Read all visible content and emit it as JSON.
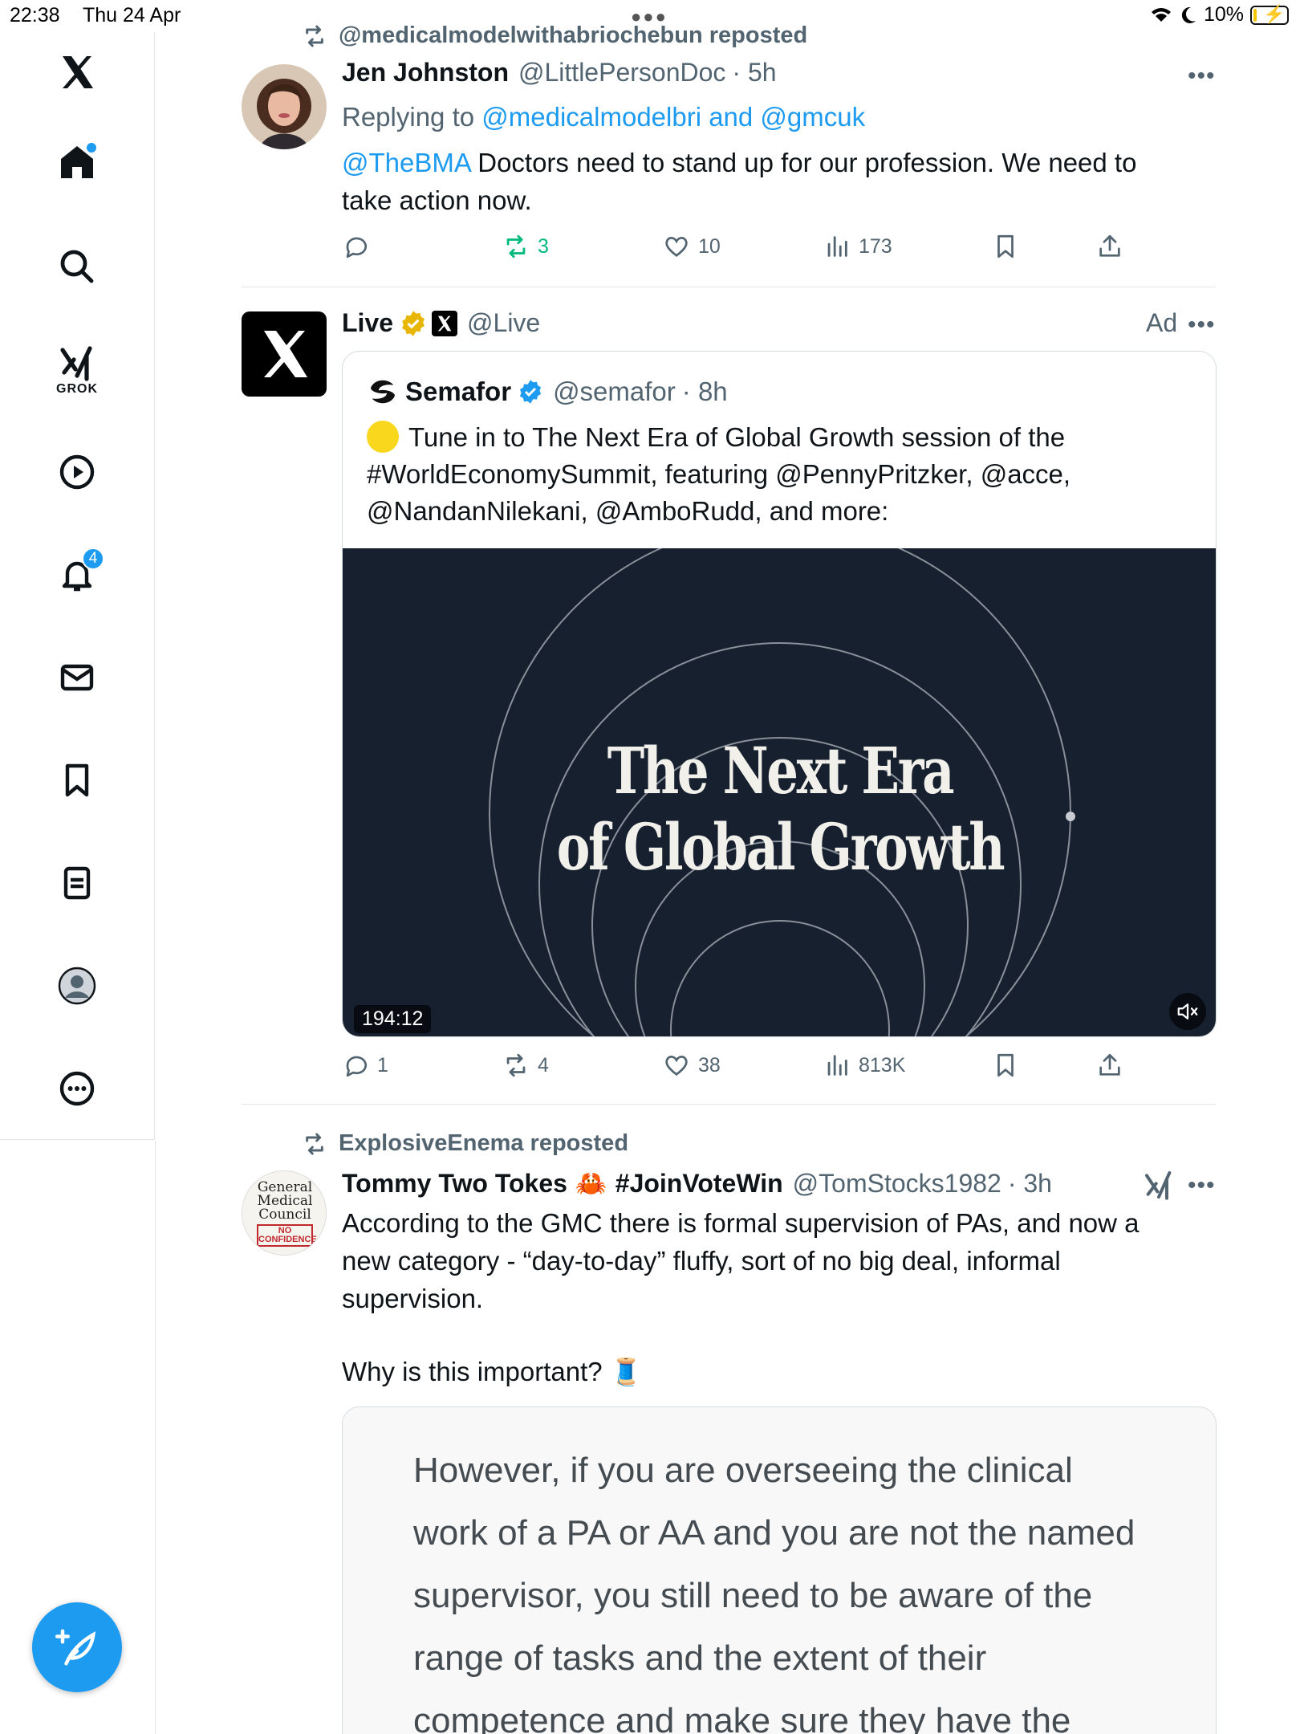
{
  "status_bar": {
    "time": "22:38",
    "date": "Thu 24 Apr",
    "battery": "10%",
    "battery_level": 0.1
  },
  "sidebar": {
    "items": [
      {
        "name": "x-logo-icon"
      },
      {
        "name": "home-icon",
        "has_unread": true
      },
      {
        "name": "search-icon"
      },
      {
        "name": "grok-icon",
        "label": "GROK"
      },
      {
        "name": "play-icon"
      },
      {
        "name": "bell-icon",
        "badge": "4"
      },
      {
        "name": "mail-icon"
      },
      {
        "name": "bookmark-icon"
      },
      {
        "name": "lists-icon"
      },
      {
        "name": "profile-icon"
      },
      {
        "name": "more-circle-icon"
      }
    ],
    "accent": "#1d9bf0"
  },
  "tweets": [
    {
      "repost_by": "@medicalmodelwithabriochebun reposted",
      "name": "Jen Johnston",
      "handle": "@LittlePersonDoc",
      "time": "· 5h",
      "replying_prefix": "Replying to ",
      "replying_to": "@medicalmodelbri and @gmcuk",
      "mention": "@TheBMA",
      "text_line1": " Doctors need to stand up for our profession. We need to",
      "text_line2": "take action now.",
      "actions": {
        "replies": "",
        "reposts": "3",
        "likes": "10",
        "views": "173"
      }
    },
    {
      "name": "Live",
      "handle": "@Live",
      "ad_label": "Ad",
      "quote": {
        "name": "Semafor",
        "handle": "@semafor",
        "time": "· 8h",
        "text_line1": "Tune in to The Next Era of Global Growth session of the",
        "text_line2": "#WorldEconomySummit, featuring @PennyPritzker, @acce,",
        "text_line3": "@NandanNilekani, @AmboRudd, and more:",
        "video_title_line1": "The Next Era",
        "video_title_line2": "of Global Growth",
        "duration": "194:12"
      },
      "actions": {
        "replies": "1",
        "reposts": "4",
        "likes": "38",
        "views": "813K"
      }
    },
    {
      "repost_by": "ExplosiveEnema reposted",
      "name": "Tommy Two Tokes",
      "name_emoji": "🦀",
      "name_tag": "#JoinVoteWin",
      "handle": "@TomStocks1982",
      "time": "· 3h",
      "avatar_text": {
        "line1": "General",
        "line2": "Medical",
        "line3": "Council",
        "stamp1": "NO",
        "stamp2": "CONFIDENCE"
      },
      "text_line1": "According to the GMC there is formal supervision of PAs, and now a",
      "text_line2": "new category - “day-to-day” fluffy, sort of no big deal, informal",
      "text_line3": "supervision.",
      "text_line4": "Why is this important? 🧵",
      "image_text": [
        "However, if you are overseeing the clinical",
        "work of a PA or AA and you are not the named",
        "supervisor, you still need to be aware of the",
        "range of tasks and the extent of their",
        "competence and make sure they have the"
      ]
    }
  ]
}
